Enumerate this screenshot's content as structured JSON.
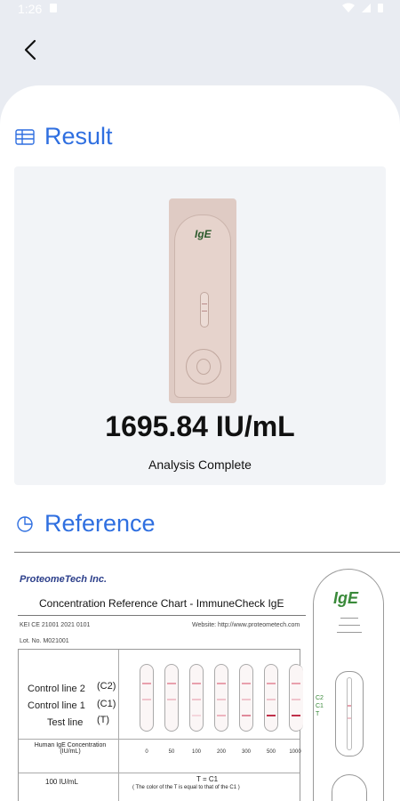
{
  "status_bar": {
    "time": "1:26",
    "battery": "▮",
    "icons": [
      "wifi-icon",
      "signal-icon",
      "battery-icon"
    ]
  },
  "header": {
    "back_icon": "chevron-left-icon"
  },
  "result": {
    "title": "Result",
    "value": "1695.84 IU/mL",
    "status": "Analysis Complete",
    "kit_label": "IgE"
  },
  "reference": {
    "title": "Reference",
    "brand": "ProteomeTech Inc.",
    "chart_title": "Concentration Reference Chart - ImmuneCheck IgE",
    "meta_left": "KEI CE 21001 2021 0101",
    "meta_right": "Website: http://www.proteometech.com",
    "lot": "Lot. No. M021001",
    "row_labels": [
      "Control line 2",
      "Control line 1",
      "Test line"
    ],
    "row_codes": [
      "(C2)",
      "(C1)",
      "(T)"
    ],
    "concentration_label": "Human IgE Concentration (IU/mL)",
    "concentrations": [
      "0",
      "50",
      "100",
      "200",
      "300",
      "500",
      "1000"
    ],
    "sample_label": "100 IU/mL",
    "note_line1": "T = C1",
    "note_line2": "( The color of the T is equal to that of the C1 )",
    "kit_label": "IgE",
    "kit_side_text": "C2 C1 T"
  },
  "colors": {
    "accent": "#2f6fe0",
    "result_bg": "#f2f4f7",
    "line_red": "#c0304a",
    "line_pink": "#e8a0ad"
  }
}
